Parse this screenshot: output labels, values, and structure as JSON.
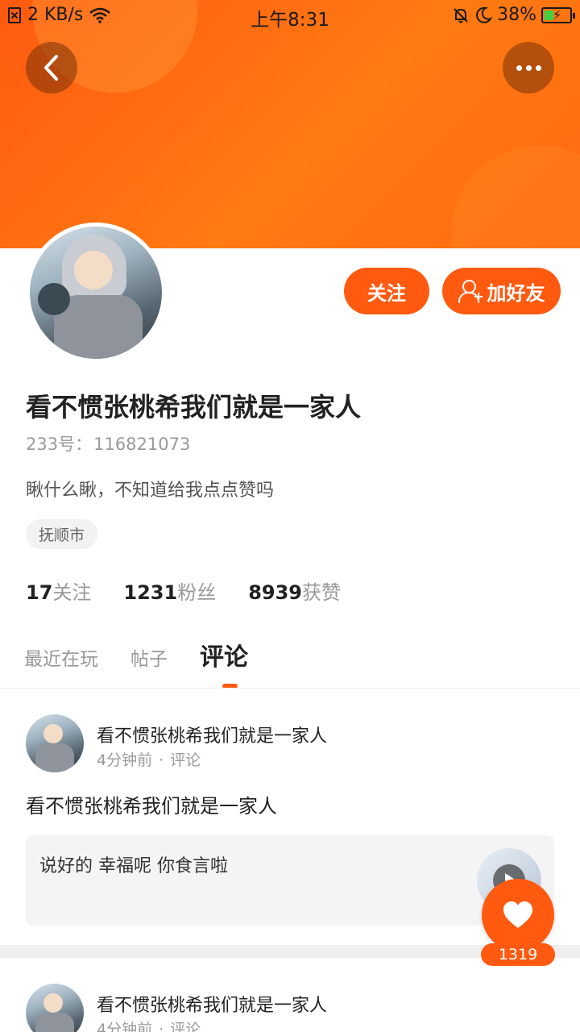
{
  "status_bar": {
    "network_speed": "2 KB/s",
    "time": "上午8:31",
    "battery": "38%",
    "battery_level": 0.38
  },
  "profile": {
    "name": "看不惯张桃希我们就是一家人",
    "uid_label": "233号：",
    "uid": "116821073",
    "bio": "瞅什么瞅，不知道给我点点赞吗",
    "location": "抚顺市",
    "follow_button": "关注",
    "add_friend_button": "加好友"
  },
  "stats": [
    {
      "num": "17",
      "label": "关注"
    },
    {
      "num": "1231",
      "label": "粉丝"
    },
    {
      "num": "8939",
      "label": "获赞"
    }
  ],
  "tabs": [
    {
      "label": "最近在玩",
      "active": false
    },
    {
      "label": "帖子",
      "active": false
    },
    {
      "label": "评论",
      "active": true
    }
  ],
  "comments": [
    {
      "author": "看不惯张桃希我们就是一家人",
      "time": "4分钟前",
      "type": "评论",
      "text": "看不惯张桃希我们就是一家人",
      "quote": "说好的  幸福呢 你食言啦"
    },
    {
      "author": "看不惯张桃希我们就是一家人",
      "time": "4分钟前",
      "type": "评论"
    }
  ],
  "like": {
    "count": "1319"
  },
  "colors": {
    "accent": "#ff5a10",
    "header_gradient_end": "#ff7a12"
  },
  "icons": {
    "back": "chevron-left-icon",
    "more": "more-dots-icon",
    "add_friend": "person-add-icon",
    "like": "heart-icon"
  }
}
